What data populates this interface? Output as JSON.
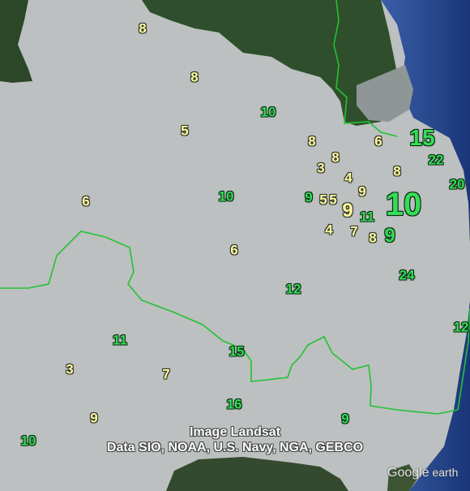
{
  "imagery": {
    "credit_lines": [
      "Image Landsat",
      "Data SIO, NOAA, U.S. Navy, NGA, GEBCO"
    ],
    "logo_text": "Google",
    "logo_suffix": "earth"
  },
  "colors": {
    "land_overlay": "#bcc0c0",
    "forest": "#2f4f2c",
    "urban": "#8e9696",
    "ocean": "#1f3f8c",
    "boundary": "#22c233",
    "label_yellow": "#ffff99",
    "label_green": "#33dd55"
  },
  "labels": [
    {
      "value": "8",
      "color": "yellow",
      "size": "norm"
    },
    {
      "value": "8",
      "color": "yellow",
      "size": "norm"
    },
    {
      "value": "10",
      "color": "green",
      "size": "norm"
    },
    {
      "value": "5",
      "color": "yellow",
      "size": "norm"
    },
    {
      "value": "8",
      "color": "yellow",
      "size": "norm"
    },
    {
      "value": "8",
      "color": "yellow",
      "size": "norm"
    },
    {
      "value": "6",
      "color": "yellow",
      "size": "norm"
    },
    {
      "value": "15",
      "color": "green",
      "size": "big"
    },
    {
      "value": "22",
      "color": "green",
      "size": "norm"
    },
    {
      "value": "3",
      "color": "yellow",
      "size": "norm"
    },
    {
      "value": "8",
      "color": "yellow",
      "size": "norm"
    },
    {
      "value": "4",
      "color": "yellow",
      "size": "norm"
    },
    {
      "value": "20",
      "color": "green",
      "size": "norm"
    },
    {
      "value": "6",
      "color": "yellow",
      "size": "norm"
    },
    {
      "value": "10",
      "color": "green",
      "size": "norm"
    },
    {
      "value": "9",
      "color": "green",
      "size": "norm"
    },
    {
      "value": "5",
      "color": "yellow",
      "size": "norm"
    },
    {
      "value": "5",
      "color": "yellow",
      "size": "norm"
    },
    {
      "value": "9",
      "color": "yellow",
      "size": "norm"
    },
    {
      "value": "10",
      "color": "green",
      "size": "huge"
    },
    {
      "value": "9",
      "color": "yellow",
      "size": "mid"
    },
    {
      "value": "11",
      "color": "green",
      "size": "norm"
    },
    {
      "value": "4",
      "color": "yellow",
      "size": "norm"
    },
    {
      "value": "7",
      "color": "yellow",
      "size": "norm"
    },
    {
      "value": "8",
      "color": "yellow",
      "size": "norm"
    },
    {
      "value": "9",
      "color": "green",
      "size": "mid"
    },
    {
      "value": "6",
      "color": "yellow",
      "size": "norm"
    },
    {
      "value": "24",
      "color": "green",
      "size": "norm"
    },
    {
      "value": "12",
      "color": "green",
      "size": "norm"
    },
    {
      "value": "12",
      "color": "green",
      "size": "norm"
    },
    {
      "value": "11",
      "color": "green",
      "size": "norm"
    },
    {
      "value": "15",
      "color": "green",
      "size": "norm"
    },
    {
      "value": "3",
      "color": "yellow",
      "size": "norm"
    },
    {
      "value": "7",
      "color": "yellow",
      "size": "norm"
    },
    {
      "value": "16",
      "color": "green",
      "size": "norm"
    },
    {
      "value": "9",
      "color": "yellow",
      "size": "norm"
    },
    {
      "value": "9",
      "color": "green",
      "size": "norm"
    },
    {
      "value": "10",
      "color": "green",
      "size": "norm"
    }
  ]
}
